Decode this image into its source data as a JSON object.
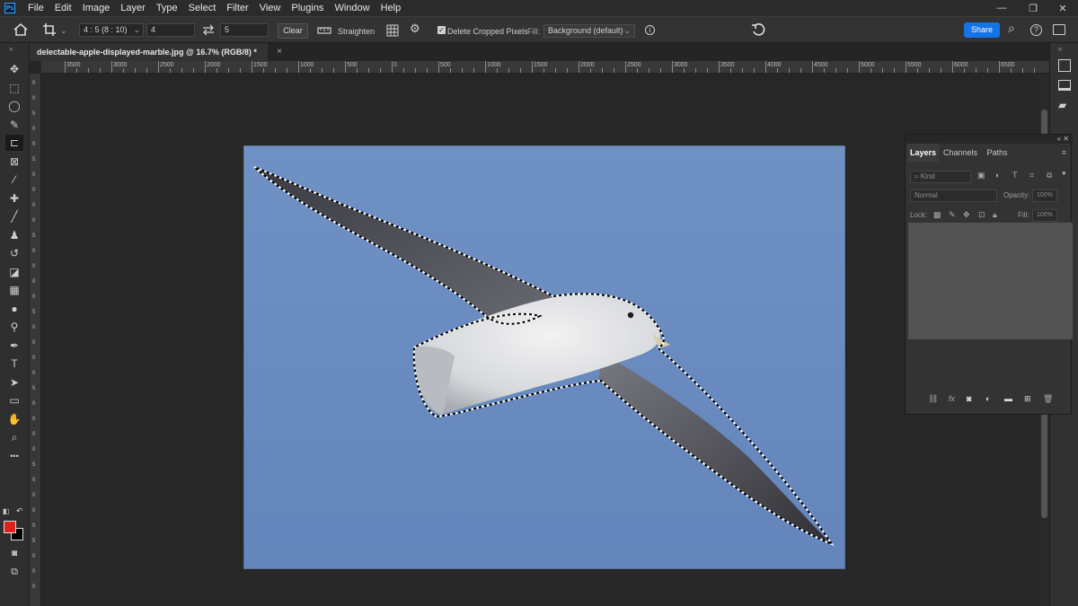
{
  "menu": {
    "items": [
      "File",
      "Edit",
      "Image",
      "Layer",
      "Type",
      "Select",
      "Filter",
      "View",
      "Plugins",
      "Window",
      "Help"
    ],
    "window_controls": [
      "—",
      "❐",
      "✕"
    ]
  },
  "options": {
    "ratio_preset": "4 : 5 (8 : 10)",
    "width_value": "4",
    "height_value": "5",
    "clear_label": "Clear",
    "straighten_label": "Straighten",
    "delete_cropped_label": "Delete Cropped Pixels",
    "delete_cropped_checked": true,
    "fill_label": "Fill:",
    "fill_value": "Background (default)",
    "share_label": "Share"
  },
  "document": {
    "tab_title": "delectable-apple-displayed-marble.jpg @ 16.7% (RGB/8) *",
    "close_glyph": "×"
  },
  "rulers": {
    "horizontal": [
      "3500",
      "3000",
      "2500",
      "2000",
      "1500",
      "1000",
      "500",
      "0",
      "500",
      "1000",
      "1500",
      "2000",
      "2500",
      "3000",
      "3500",
      "4000",
      "4500",
      "5000",
      "5500",
      "6000",
      "6500"
    ],
    "vertical": [
      "0",
      "0",
      "5",
      "0",
      "0",
      "5",
      "0",
      "0",
      "0",
      "0",
      "5",
      "0",
      "0",
      "0",
      "0",
      "5",
      "0",
      "0",
      "0",
      "0",
      "5",
      "0",
      "0",
      "0",
      "0",
      "5",
      "0",
      "0",
      "0",
      "0",
      "5",
      "0",
      "0",
      "0"
    ]
  },
  "tools": [
    {
      "name": "move-tool",
      "icon": "✥"
    },
    {
      "name": "marquee-tool",
      "icon": "⬚"
    },
    {
      "name": "lasso-tool",
      "icon": "◯"
    },
    {
      "name": "quick-select-tool",
      "icon": "✎"
    },
    {
      "name": "crop-tool",
      "icon": "⊏"
    },
    {
      "name": "frame-tool",
      "icon": "⊠"
    },
    {
      "name": "eyedropper-tool",
      "icon": "⁄"
    },
    {
      "name": "healing-brush-tool",
      "icon": "✚"
    },
    {
      "name": "brush-tool",
      "icon": "╱"
    },
    {
      "name": "clone-stamp-tool",
      "icon": "♟"
    },
    {
      "name": "history-brush-tool",
      "icon": "↺"
    },
    {
      "name": "eraser-tool",
      "icon": "◪"
    },
    {
      "name": "gradient-tool",
      "icon": "▦"
    },
    {
      "name": "blur-tool",
      "icon": "●"
    },
    {
      "name": "dodge-tool",
      "icon": "⚲"
    },
    {
      "name": "pen-tool",
      "icon": "✒"
    },
    {
      "name": "type-tool",
      "icon": "T"
    },
    {
      "name": "path-select-tool",
      "icon": "➤"
    },
    {
      "name": "rectangle-tool",
      "icon": "▭"
    },
    {
      "name": "hand-tool",
      "icon": "✋"
    },
    {
      "name": "zoom-tool",
      "icon": "⌕"
    },
    {
      "name": "more-tools",
      "icon": "•••"
    }
  ],
  "colors": {
    "foreground": "#e01f1f",
    "background": "#000000",
    "share_blue": "#1473e6",
    "sky": "#6a8cc0"
  },
  "layers_panel": {
    "collapse": "« ✕",
    "tabs": [
      "Layers",
      "Channels",
      "Paths"
    ],
    "active_tab": "Layers",
    "kind_placeholder": "Kind",
    "blend_mode": "Normal",
    "opacity_label": "Opacity:",
    "opacity_value": "100%",
    "lock_label": "Lock:",
    "fill_label": "Fill:",
    "fill_value": "100%"
  }
}
